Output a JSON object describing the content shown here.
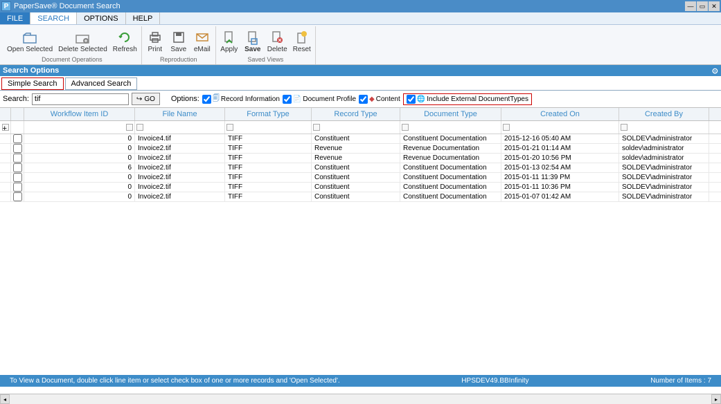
{
  "app": {
    "title": "PaperSave® Document Search"
  },
  "menu": {
    "file": "FILE",
    "search": "SEARCH",
    "options": "OPTIONS",
    "help": "HELP"
  },
  "ribbon": {
    "groups": [
      {
        "label": "Document Operations",
        "items": [
          {
            "label": "Open Selected"
          },
          {
            "label": "Delete Selected"
          },
          {
            "label": "Refresh"
          }
        ]
      },
      {
        "label": "Reproduction",
        "items": [
          {
            "label": "Print"
          },
          {
            "label": "Save"
          },
          {
            "label": "eMail"
          }
        ]
      },
      {
        "label": "Saved Views",
        "items": [
          {
            "label": "Apply"
          },
          {
            "label": "Save"
          },
          {
            "label": "Delete"
          },
          {
            "label": "Reset"
          }
        ]
      }
    ]
  },
  "section": {
    "title": "Search Options"
  },
  "searchtabs": {
    "simple": "Simple Search",
    "advanced": "Advanced Search"
  },
  "search": {
    "label": "Search:",
    "value": "tif",
    "go": "GO",
    "options_label": "Options:",
    "opt_record_info": "Record Information",
    "opt_doc_profile": "Document Profile",
    "opt_content": "Content",
    "opt_ext": "Include External DocumentTypes"
  },
  "grid": {
    "columns": [
      "Workflow Item ID",
      "File Name",
      "Format Type",
      "Record Type",
      "Document Type",
      "Created On",
      "Created By"
    ],
    "rows": [
      {
        "wid": "0",
        "fn": "Invoice4.tif",
        "ft": "TIFF",
        "rt": "Constituent",
        "dt": "Constituent Documentation",
        "co": "2015-12-16 05:40 AM",
        "cb": "SOLDEV\\administrator"
      },
      {
        "wid": "0",
        "fn": "Invoice2.tif",
        "ft": "TIFF",
        "rt": "Revenue",
        "dt": "Revenue Documentation",
        "co": "2015-01-21 01:14 AM",
        "cb": "soldev\\administrator"
      },
      {
        "wid": "0",
        "fn": "Invoice2.tif",
        "ft": "TIFF",
        "rt": "Revenue",
        "dt": "Revenue Documentation",
        "co": "2015-01-20 10:56 PM",
        "cb": "soldev\\administrator"
      },
      {
        "wid": "6",
        "fn": "Invoice2.tif",
        "ft": "TIFF",
        "rt": "Constituent",
        "dt": "Constituent Documentation",
        "co": "2015-01-13 02:54 AM",
        "cb": "SOLDEV\\administrator"
      },
      {
        "wid": "0",
        "fn": "Invoice2.tif",
        "ft": "TIFF",
        "rt": "Constituent",
        "dt": "Constituent Documentation",
        "co": "2015-01-11 11:39 PM",
        "cb": "SOLDEV\\administrator"
      },
      {
        "wid": "0",
        "fn": "Invoice2.tif",
        "ft": "TIFF",
        "rt": "Constituent",
        "dt": "Constituent Documentation",
        "co": "2015-01-11 10:36 PM",
        "cb": "SOLDEV\\administrator"
      },
      {
        "wid": "0",
        "fn": "Invoice2.tif",
        "ft": "TIFF",
        "rt": "Constituent",
        "dt": "Constituent Documentation",
        "co": "2015-01-07 01:42 AM",
        "cb": "SOLDEV\\administrator"
      }
    ]
  },
  "status": {
    "hint": "To View a Document, double click line item or select check box of one or more records and 'Open Selected'.",
    "server": "HPSDEV49.BBInfinity",
    "count_label": "Number of Items :",
    "count": "7"
  }
}
